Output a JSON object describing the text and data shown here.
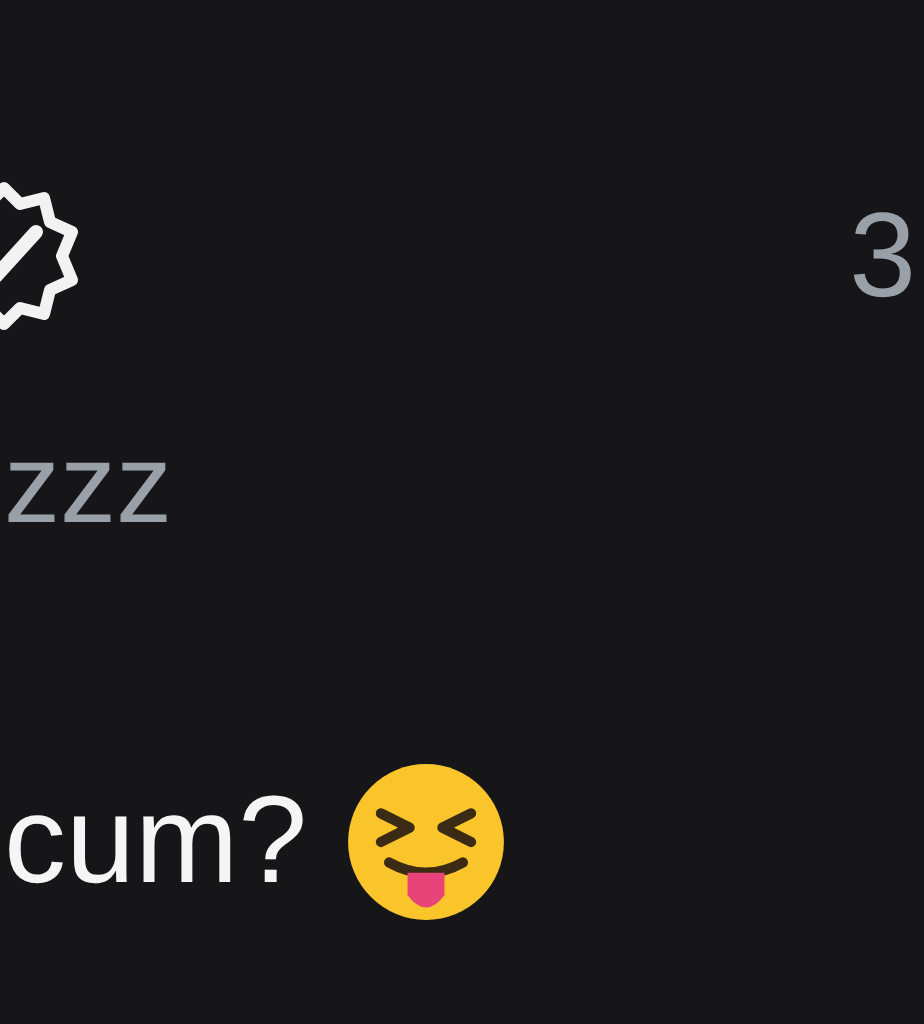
{
  "header": {
    "verified": true,
    "count": "3"
  },
  "handle": "zzz",
  "post": {
    "text": "cum?"
  }
}
